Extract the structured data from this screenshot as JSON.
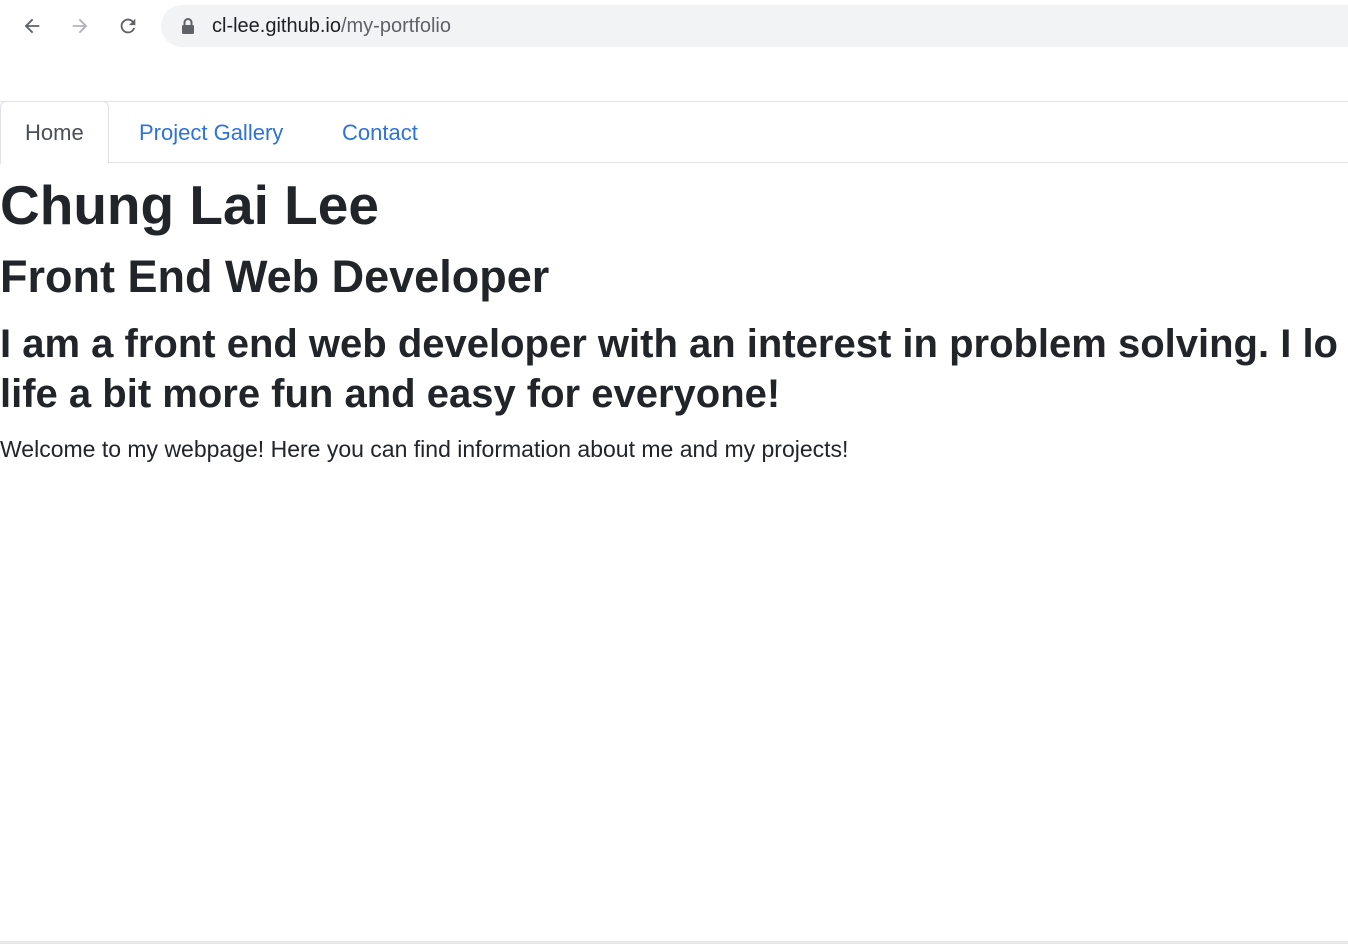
{
  "browser": {
    "url_host": "cl-lee.github.io",
    "url_path": "/my-portfolio",
    "icons": [
      "back-arrow-icon",
      "forward-arrow-icon",
      "reload-icon",
      "lock-icon"
    ]
  },
  "nav": {
    "tabs": [
      {
        "label": "Home",
        "active": true
      },
      {
        "label": "Project Gallery",
        "active": false
      },
      {
        "label": "Contact",
        "active": false
      }
    ]
  },
  "main": {
    "name": "Chung Lai Lee",
    "role": "Front End Web Developer",
    "intro_line1": "I am a front end web developer with an interest in problem solving. I lo",
    "intro_line2": "life a bit more fun and easy for everyone!",
    "welcome": "Welcome to my webpage! Here you can find information about me and my projects!"
  },
  "colors": {
    "link": "#2d73d9",
    "text": "#212529",
    "active_tab_text": "#495057",
    "omnibox_bg": "#f1f3f4"
  }
}
